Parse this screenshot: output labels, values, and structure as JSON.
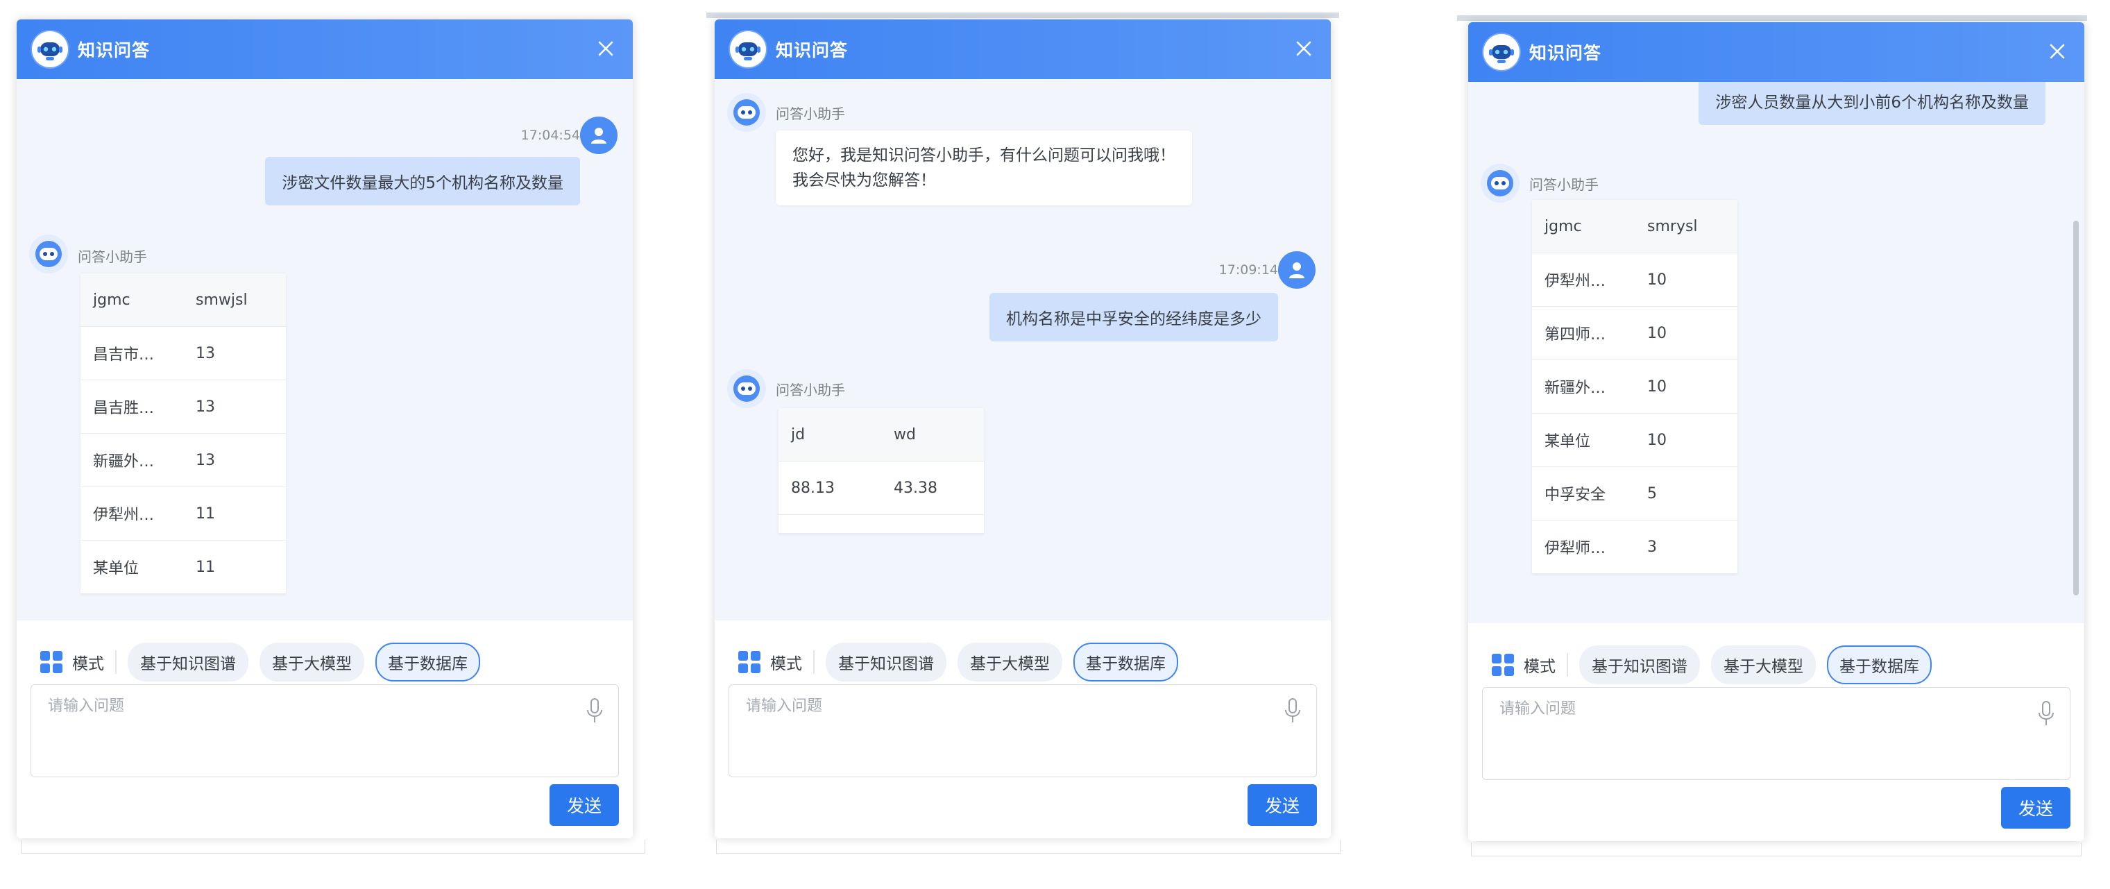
{
  "panels": [
    {
      "header_title": "知识问答",
      "user_time": "17:04:54",
      "user_question": "涉密文件数量最大的5个机构名称及数量",
      "bot_name": "问答小助手",
      "table": {
        "headers": [
          "jgmc",
          "smwjsl"
        ],
        "rows": [
          [
            "昌吉市…",
            "13"
          ],
          [
            "昌吉胜…",
            "13"
          ],
          [
            "新疆外…",
            "13"
          ],
          [
            "伊犁州…",
            "11"
          ],
          [
            "某单位",
            "11"
          ]
        ]
      },
      "mode_label": "模式",
      "chips": [
        "基于知识图谱",
        "基于大模型",
        "基于数据库"
      ],
      "placeholder": "请输入问题",
      "send_label": "发送"
    },
    {
      "header_title": "知识问答",
      "bot_name": "问答小助手",
      "greeting_line1": "您好，我是知识问答小助手，有什么问题可以问我哦！",
      "greeting_line2": "我会尽快为您解答！",
      "user_time": "17:09:14",
      "user_question": "机构名称是中孚安全的经纬度是多少",
      "bot_name_2": "问答小助手",
      "table": {
        "headers": [
          "jd",
          "wd"
        ],
        "rows": [
          [
            "88.13",
            "43.38"
          ]
        ]
      },
      "mode_label": "模式",
      "chips": [
        "基于知识图谱",
        "基于大模型",
        "基于数据库"
      ],
      "placeholder": "请输入问题",
      "send_label": "发送"
    },
    {
      "header_title": "知识问答",
      "user_question": "涉密人员数量从大到小前6个机构名称及数量",
      "bot_name": "问答小助手",
      "table": {
        "headers": [
          "jgmc",
          "smrysl"
        ],
        "rows": [
          [
            "伊犁州…",
            "10"
          ],
          [
            "第四师…",
            "10"
          ],
          [
            "新疆外…",
            "10"
          ],
          [
            "某单位",
            "10"
          ],
          [
            "中孚安全",
            "5"
          ],
          [
            "伊犁师…",
            "3"
          ]
        ]
      },
      "mode_label": "模式",
      "chips": [
        "基于知识图谱",
        "基于大模型",
        "基于数据库"
      ],
      "placeholder": "请输入问题",
      "send_label": "发送"
    }
  ],
  "colors": {
    "header": "#3f84f3",
    "active_chip_border": "#3f84f3",
    "send_button": "#2a78ee",
    "user_bubble": "#cfe0fd",
    "chat_background": "#f2f5fb"
  },
  "icons": {
    "logo": "robot-logo-icon",
    "close": "close-icon",
    "user": "user-avatar-icon",
    "bot": "robot-avatar-icon",
    "mode": "grid-icon",
    "mic": "microphone-icon"
  }
}
